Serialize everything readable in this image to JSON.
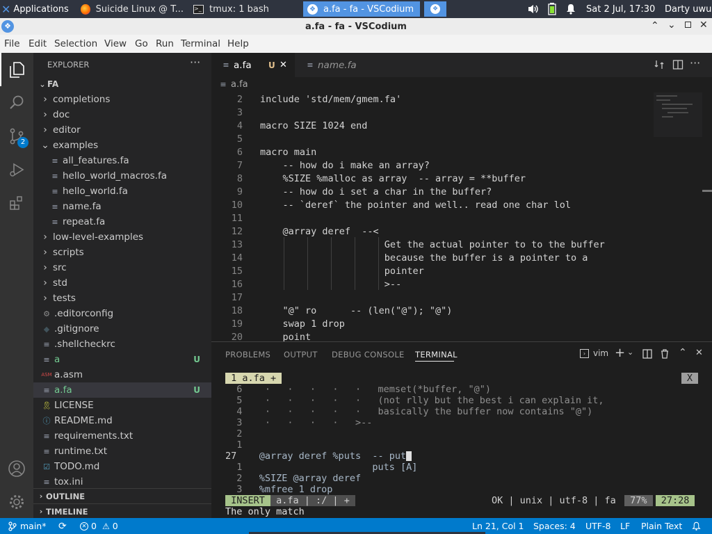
{
  "panel": {
    "apps_label": "Applications",
    "tasks": [
      "Suicide Linux @ T...",
      "tmux: 1 bash",
      "a.fa - fa - VSCodium"
    ],
    "clock": "Sat  2 Jul, 17:30",
    "user": "Darty uwu"
  },
  "window": {
    "title": "a.fa - fa - VSCodium"
  },
  "menubar": [
    "File",
    "Edit",
    "Selection",
    "View",
    "Go",
    "Run",
    "Terminal",
    "Help"
  ],
  "activity": {
    "scm_badge": "2"
  },
  "sidebar": {
    "header": "EXPLORER",
    "root": "FA",
    "items": [
      {
        "label": "completions",
        "type": "folder",
        "open": false,
        "depth": 1
      },
      {
        "label": "doc",
        "type": "folder",
        "open": false,
        "depth": 1
      },
      {
        "label": "editor",
        "type": "folder",
        "open": false,
        "depth": 1
      },
      {
        "label": "examples",
        "type": "folder",
        "open": true,
        "depth": 1
      },
      {
        "label": "all_features.fa",
        "type": "file",
        "icon": "lines",
        "depth": 2
      },
      {
        "label": "hello_world_macros.fa",
        "type": "file",
        "icon": "lines",
        "depth": 2
      },
      {
        "label": "hello_world.fa",
        "type": "file",
        "icon": "lines",
        "depth": 2
      },
      {
        "label": "name.fa",
        "type": "file",
        "icon": "lines",
        "depth": 2
      },
      {
        "label": "repeat.fa",
        "type": "file",
        "icon": "lines",
        "depth": 2
      },
      {
        "label": "low-level-examples",
        "type": "folder",
        "open": false,
        "depth": 1
      },
      {
        "label": "scripts",
        "type": "folder",
        "open": false,
        "depth": 1
      },
      {
        "label": "src",
        "type": "folder",
        "open": false,
        "depth": 1
      },
      {
        "label": "std",
        "type": "folder",
        "open": false,
        "depth": 1
      },
      {
        "label": "tests",
        "type": "folder",
        "open": false,
        "depth": 1
      },
      {
        "label": ".editorconfig",
        "type": "file",
        "icon": "gear",
        "depth": 1
      },
      {
        "label": ".gitignore",
        "type": "file",
        "icon": "git",
        "depth": 1
      },
      {
        "label": ".shellcheckrc",
        "type": "file",
        "icon": "lines",
        "depth": 1
      },
      {
        "label": "a",
        "type": "file",
        "icon": "lines",
        "depth": 1,
        "badge": "U"
      },
      {
        "label": "a.asm",
        "type": "file",
        "icon": "asm",
        "depth": 1
      },
      {
        "label": "a.fa",
        "type": "file",
        "icon": "lines",
        "depth": 1,
        "badge": "U",
        "selected": true
      },
      {
        "label": "LICENSE",
        "type": "file",
        "icon": "license",
        "depth": 1
      },
      {
        "label": "README.md",
        "type": "file",
        "icon": "info",
        "depth": 1
      },
      {
        "label": "requirements.txt",
        "type": "file",
        "icon": "lines",
        "depth": 1
      },
      {
        "label": "runtime.txt",
        "type": "file",
        "icon": "lines",
        "depth": 1
      },
      {
        "label": "TODO.md",
        "type": "file",
        "icon": "todo",
        "depth": 1
      },
      {
        "label": "tox.ini",
        "type": "file",
        "icon": "lines",
        "depth": 1
      }
    ],
    "outline": "OUTLINE",
    "timeline": "TIMELINE"
  },
  "tabs": [
    {
      "label": "a.fa",
      "badge": "U",
      "active": true
    },
    {
      "label": "name.fa",
      "active": false
    }
  ],
  "breadcrumb": "a.fa",
  "code": [
    {
      "n": "2",
      "t": "include 'std/mem/gmem.fa'"
    },
    {
      "n": "3",
      "t": ""
    },
    {
      "n": "4",
      "t": "macro SIZE 1024 end"
    },
    {
      "n": "5",
      "t": ""
    },
    {
      "n": "6",
      "t": "macro main"
    },
    {
      "n": "7",
      "t": "    -- how do i make an array?"
    },
    {
      "n": "8",
      "t": "    %SIZE %malloc as array  -- array = **buffer"
    },
    {
      "n": "9",
      "t": "    -- how do i set a char in the buffer?"
    },
    {
      "n": "10",
      "t": "    -- `deref` the pointer and well.. read one char lol"
    },
    {
      "n": "11",
      "t": ""
    },
    {
      "n": "12",
      "t": "    @array deref  --<"
    },
    {
      "n": "13",
      "t": "                      Get the actual pointer to to the buffer"
    },
    {
      "n": "14",
      "t": "                      because the buffer is a pointer to a"
    },
    {
      "n": "15",
      "t": "                      pointer"
    },
    {
      "n": "16",
      "t": "                      >--"
    },
    {
      "n": "17",
      "t": ""
    },
    {
      "n": "18",
      "t": "    \"@\" ro      -- (len(\"@\"); \"@\")"
    },
    {
      "n": "19",
      "t": "    swap 1 drop"
    },
    {
      "n": "20",
      "t": "    point"
    }
  ],
  "panel_tabs": [
    "PROBLEMS",
    "OUTPUT",
    "DEBUG CONSOLE",
    "TERMINAL"
  ],
  "terminal_shell": "vim",
  "terminal": {
    "buffer_tab": " 1 a.fa + ",
    "close_x": "X",
    "lines": [
      {
        "n": "  6",
        "t": "    ·   ·   ·   ·   ·   memset(*buffer, \"@\")",
        "dim": true
      },
      {
        "n": "  5",
        "t": "    ·   ·   ·   ·   ·   (not rlly but the best i can explain it,",
        "dim": true
      },
      {
        "n": "  4",
        "t": "    ·   ·   ·   ·   ·   basically the buffer now contains \"@\")",
        "dim": true
      },
      {
        "n": "  3",
        "t": "    ·   ·   ·   ·   >--",
        "dim": true
      },
      {
        "n": "  2",
        "t": ""
      },
      {
        "n": "  1",
        "t": ""
      },
      {
        "n": "27 ",
        "t": "   @array deref %puts  -- put",
        "cursor": true
      },
      {
        "n": "  1",
        "t": "                       puts [A]"
      },
      {
        "n": "  2",
        "t": "   %SIZE @array deref"
      },
      {
        "n": "  3",
        "t": "   %mfree 1 drop"
      }
    ],
    "mode": " INSERT ",
    "file_seg": " a.fa | :/ | + ",
    "status_right": "OK | unix | utf-8 | fa ",
    "percent": " 77% ",
    "position": " 27:28 ",
    "message": "The only match"
  },
  "status": {
    "branch": "main*",
    "errors": "0",
    "warnings": "0",
    "position": "Ln 21, Col 1",
    "spaces": "Spaces: 4",
    "encoding": "UTF-8",
    "eol": "LF",
    "language": "Plain Text"
  },
  "colors": {
    "accent": "#007acc",
    "panel_bg": "#2f343f",
    "vim_mode": "#a6c38a"
  }
}
